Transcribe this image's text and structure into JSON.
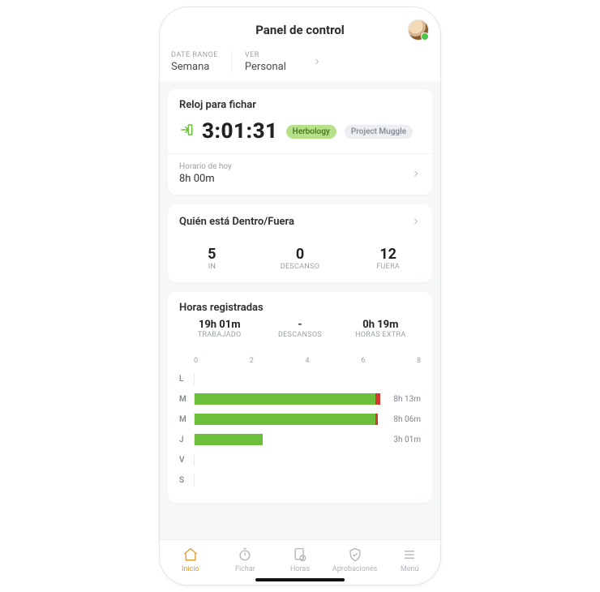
{
  "header": {
    "title": "Panel de control",
    "filters": {
      "date_range_label": "DATE RANGE",
      "date_range_value": "Semana",
      "view_label": "VER",
      "view_value": "Personal"
    }
  },
  "timeclock": {
    "title": "Reloj para fichar",
    "elapsed": "3:01:31",
    "tags": [
      "Herbology",
      "Project Muggle"
    ],
    "schedule_label": "Horario de hoy",
    "schedule_value": "8h 00m"
  },
  "presence": {
    "title": "Quién está Dentro/Fuera",
    "stats": [
      {
        "value": "5",
        "label": "IN"
      },
      {
        "value": "0",
        "label": "DESCANSO"
      },
      {
        "value": "12",
        "label": "FUERA"
      }
    ]
  },
  "hours": {
    "title": "Horas registradas",
    "summary": [
      {
        "value": "19h 01m",
        "label": "TRABAJADO"
      },
      {
        "value": "-",
        "label": "DESCANSOS"
      },
      {
        "value": "0h 19m",
        "label": "HORAS EXTRA"
      }
    ]
  },
  "chart_data": {
    "type": "bar",
    "xlabel": "",
    "ylabel": "",
    "ticks": [
      "0",
      "2",
      "4",
      "6",
      "8"
    ],
    "max": 8,
    "days": [
      {
        "label": "L",
        "worked_h": 0,
        "overtime_h": 0,
        "display": ""
      },
      {
        "label": "M",
        "worked_h": 8.0,
        "overtime_h": 0.22,
        "display": "8h 13m"
      },
      {
        "label": "M",
        "worked_h": 8.0,
        "overtime_h": 0.1,
        "display": "8h 06m"
      },
      {
        "label": "J",
        "worked_h": 3.02,
        "overtime_h": 0,
        "display": "3h 01m"
      },
      {
        "label": "V",
        "worked_h": 0,
        "overtime_h": 0,
        "display": ""
      },
      {
        "label": "S",
        "worked_h": 0,
        "overtime_h": 0,
        "display": ""
      }
    ]
  },
  "tabs": [
    {
      "id": "home",
      "label": "Inicio"
    },
    {
      "id": "clock",
      "label": "Fichar"
    },
    {
      "id": "hours",
      "label": "Horas"
    },
    {
      "id": "approve",
      "label": "Aprobaciones"
    },
    {
      "id": "menu",
      "label": "Menú"
    }
  ],
  "colors": {
    "accent_green": "#6bbf3b",
    "accent_orange": "#e09a2c",
    "overtime_red": "#d13a2f"
  }
}
